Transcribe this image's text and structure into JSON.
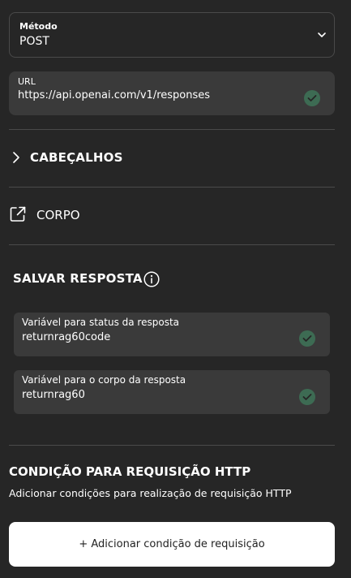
{
  "method": {
    "label": "Método",
    "value": "POST",
    "icon": "chevron-down-icon"
  },
  "url": {
    "label": "URL",
    "value": "https://api.openai.com/v1/responses",
    "valid_icon": "check-circle-icon"
  },
  "sections": {
    "headers": "CABEÇALHOS",
    "body": "CORPO"
  },
  "save_response": {
    "title": "SALVAR RESPOSTA",
    "status_variable": {
      "label": "Variável para status da resposta",
      "value": "returnrag60code"
    },
    "body_variable": {
      "label": "Variável para o corpo da resposta",
      "value": "returnrag60"
    }
  },
  "condition": {
    "title": "CONDIÇÃO PARA REQUISIÇÃO HTTP",
    "subtitle": "Adicionar condições para realização de requisição HTTP",
    "add_button": "+ Adicionar condição de requisição"
  },
  "colors": {
    "background": "#262626",
    "field": "#3a3a3a",
    "check": "#3d6b53",
    "button": "#ffffff"
  }
}
